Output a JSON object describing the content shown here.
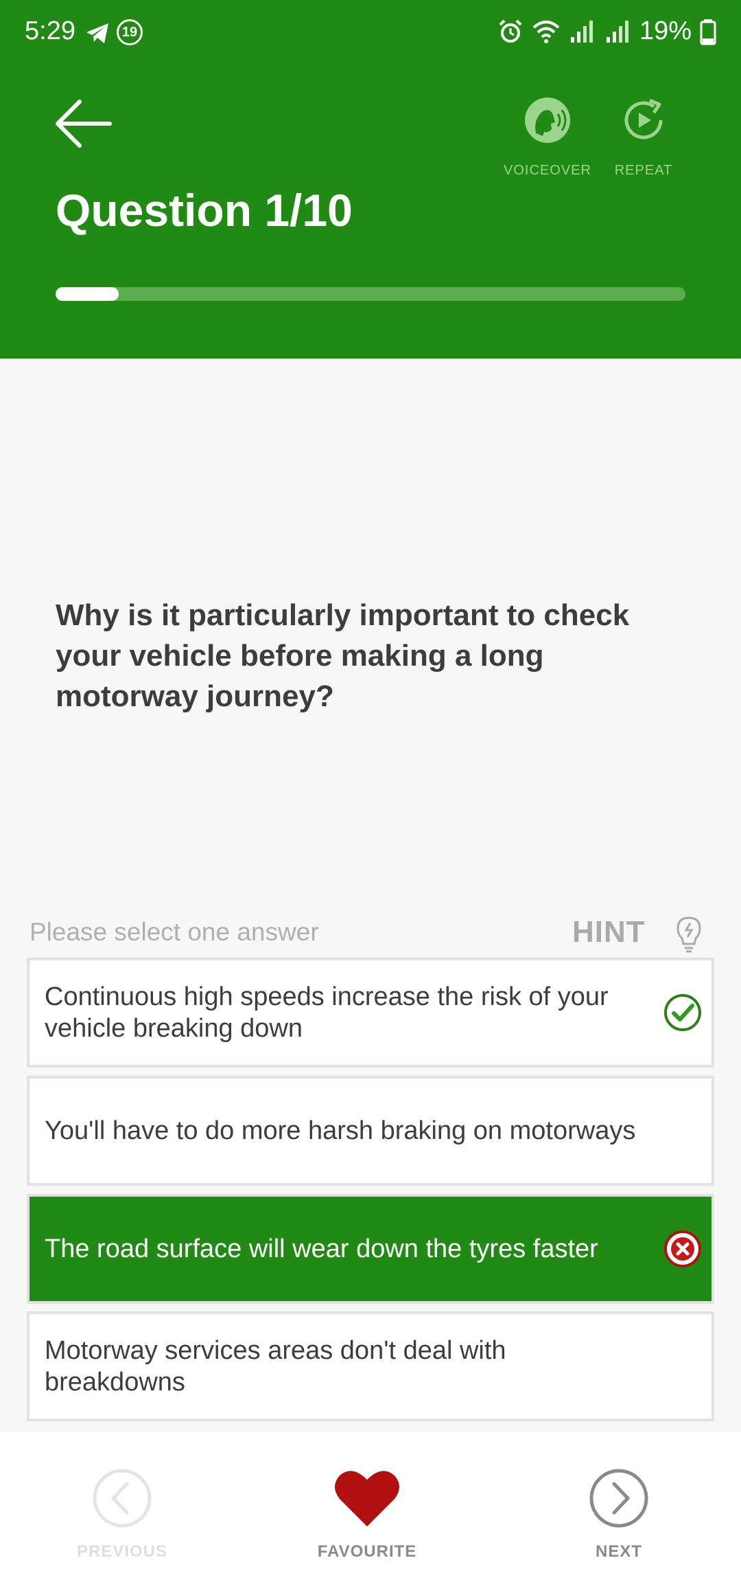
{
  "status_bar": {
    "time": "5:29",
    "notification_count": "19",
    "battery": "19%",
    "icons": [
      "telegram-icon",
      "notification-badge-icon",
      "alarm-icon",
      "wifi-icon",
      "signal-icon",
      "signal-icon",
      "battery-icon"
    ]
  },
  "header": {
    "title": "Question 1/10",
    "voiceover_label": "VOICEOVER",
    "repeat_label": "REPEAT",
    "progress": 0.1,
    "bg_color": "#218a14"
  },
  "question": {
    "text": "Why is it particularly important to check your vehicle before making a long motorway journey?"
  },
  "answers_section": {
    "prompt": "Please select one answer",
    "hint_label": "HINT"
  },
  "answers": [
    {
      "text": "Continuous high speeds increase the risk of your vehicle breaking down",
      "status": "correct"
    },
    {
      "text": "You'll have to do more harsh braking on motorways",
      "status": "none"
    },
    {
      "text": "The road surface will wear down the tyres faster",
      "status": "wrong-selected"
    },
    {
      "text": "Motorway services areas don't deal with breakdowns",
      "status": "none"
    }
  ],
  "bottom_nav": {
    "previous_label": "PREVIOUS",
    "favourite_label": "FAVOURITE",
    "next_label": "NEXT",
    "favourite_color": "#b01010"
  }
}
